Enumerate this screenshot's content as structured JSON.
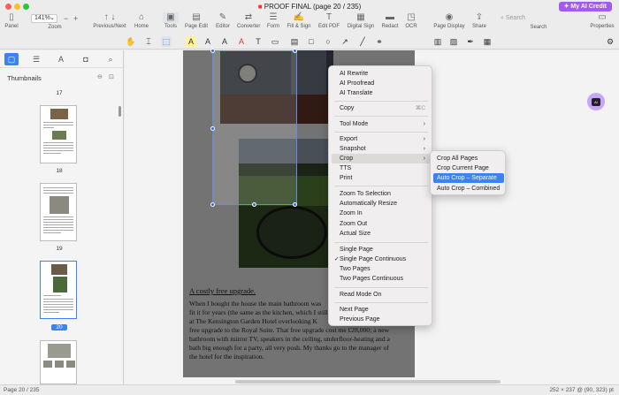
{
  "window": {
    "title": "PROOF FINAL (page 20 / 235)",
    "ai_credit": "My AI Credit",
    "colors": {
      "accent": "#3b82f6",
      "ai": "#a259f7"
    }
  },
  "toolbar": {
    "zoom_value": "141%",
    "search_placeholder": "Search",
    "items": {
      "panel": "Panel",
      "zoom": "Zoom",
      "prevnext": "Previous/Next",
      "home": "Home",
      "tools": "Tools",
      "page_edit": "Page Edit",
      "editor": "Editor",
      "converter": "Converter",
      "form": "Form",
      "fill_sign": "Fill & Sign",
      "edit_pdf": "Edit PDF",
      "digital_sign": "Digital Sign",
      "redact": "Redact",
      "ocr": "OCR",
      "page_display": "Page Display",
      "share": "Share",
      "search": "Search",
      "properties": "Properties"
    }
  },
  "sidebar": {
    "title": "Thumbnails",
    "page_numbers": [
      "17",
      "18",
      "19",
      "20"
    ],
    "current_page": "20"
  },
  "document": {
    "article_title": "A costly free upgrade.",
    "paragraph_lines": [
      "When I bought the house the main bathroom was",
      "fit it for years (the same as the kitchen, which I still",
      "at The Kensington Garden Hotel overlooking K",
      "free upgrade to the Royal Suite. That free upgrade cost me £28,000; a new",
      "bathroom with mirror TV, speakers in the ceiling, underfloor-heating and a",
      "bath big enough for a party, all very posh. My thanks go to the manager of",
      "the hotel for the inspiration."
    ]
  },
  "context_menu": {
    "items": [
      {
        "label": "AI Rewrite"
      },
      {
        "label": "AI Proofread"
      },
      {
        "label": "AI Translate"
      },
      {
        "label": "Copy",
        "shortcut": "⌘C"
      },
      {
        "label": "Tool Mode",
        "submenu": true
      },
      {
        "label": "Export",
        "submenu": true
      },
      {
        "label": "Snapshot",
        "submenu": true
      },
      {
        "label": "Crop",
        "submenu": true
      },
      {
        "label": "TTS"
      },
      {
        "label": "Print"
      },
      {
        "label": "Zoom To Selection"
      },
      {
        "label": "Automatically Resize"
      },
      {
        "label": "Zoom In"
      },
      {
        "label": "Zoom Out"
      },
      {
        "label": "Actual Size"
      },
      {
        "label": "Single Page"
      },
      {
        "label": "Single Page Continuous",
        "checked": true
      },
      {
        "label": "Two Pages"
      },
      {
        "label": "Two Pages Continuous"
      },
      {
        "label": "Read Mode On"
      },
      {
        "label": "Next Page"
      },
      {
        "label": "Previous Page"
      }
    ],
    "crop_submenu": [
      "Crop All Pages",
      "Crop Current Page",
      "Auto Crop – Separate",
      "Auto Crop – Combined"
    ]
  },
  "status": {
    "left": "Page 20 / 235",
    "right": "252 × 237 @ (90, 323) pt"
  }
}
